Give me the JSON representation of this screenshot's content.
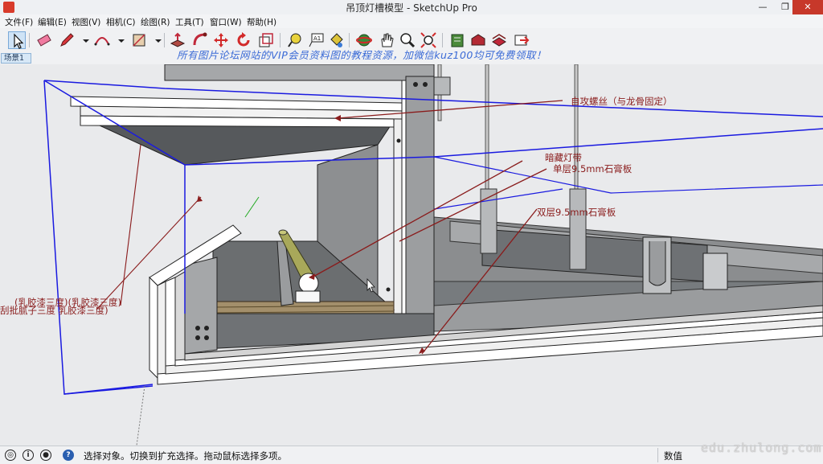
{
  "window": {
    "title": "吊顶灯槽模型 - SketchUp Pro",
    "minimize": "—",
    "maximize": "❐",
    "close": "✕"
  },
  "menu": [
    {
      "label": "文件(F)"
    },
    {
      "label": "编辑(E)"
    },
    {
      "label": "视图(V)"
    },
    {
      "label": "相机(C)"
    },
    {
      "label": "绘图(R)"
    },
    {
      "label": "工具(T)"
    },
    {
      "label": "窗口(W)"
    },
    {
      "label": "帮助(H)"
    }
  ],
  "toolbar": {
    "tools": [
      "select-icon",
      "eraser-icon",
      "pencil-icon",
      "arc-icon",
      "rectangle-icon",
      "push-pull-icon",
      "follow-me-icon",
      "move-icon",
      "rotate-icon",
      "scale-icon",
      "tape-measure-icon",
      "text-icon",
      "paint-bucket-icon",
      "orbit-icon",
      "pan-icon",
      "zoom-icon",
      "zoom-extents-icon",
      "warehouse-icon",
      "extension-warehouse-icon",
      "layout-icon",
      "share-icon"
    ]
  },
  "scene": {
    "tab_label": "场景1"
  },
  "banner": "所有图片论坛网站的VIP会员资料图的教程资源，加微信kuz100均可免费领取！",
  "annotations": {
    "screw": "自攻螺丝（与龙骨固定）",
    "led_strip": "暗藏灯带",
    "single_board": "单层9.5mm石膏板",
    "double_board": "双层9.5mm石膏板",
    "paint_a": "(乳胶漆三度)(乳胶漆三度)",
    "paint_b": "刮批腻子三度 乳胶漆三度)"
  },
  "status": {
    "text": "选择对象。切换到扩充选择。拖动鼠标选择多项。",
    "measure_label": "数值"
  },
  "watermark": "edu.zhulong.com"
}
